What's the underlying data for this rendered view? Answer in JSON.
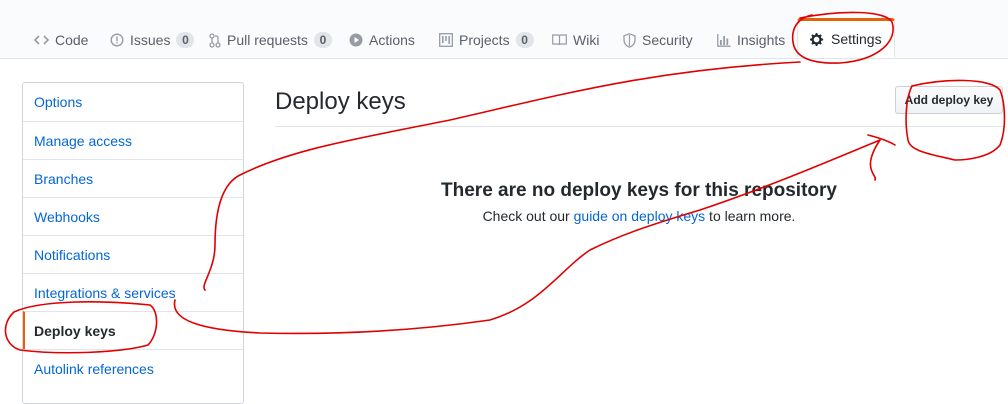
{
  "repo_nav": {
    "tabs": [
      {
        "label": "Code",
        "icon": "code-icon"
      },
      {
        "label": "Issues",
        "icon": "issue-icon",
        "count": "0"
      },
      {
        "label": "Pull requests",
        "icon": "pull-request-icon",
        "count": "0"
      },
      {
        "label": "Actions",
        "icon": "play-icon"
      },
      {
        "label": "Projects",
        "icon": "project-icon",
        "count": "0"
      },
      {
        "label": "Wiki",
        "icon": "book-icon"
      },
      {
        "label": "Security",
        "icon": "shield-icon"
      },
      {
        "label": "Insights",
        "icon": "graph-icon"
      },
      {
        "label": "Settings",
        "icon": "gear-icon",
        "selected": true
      }
    ]
  },
  "sidebar": {
    "items": [
      {
        "label": "Options"
      },
      {
        "label": "Manage access"
      },
      {
        "label": "Branches"
      },
      {
        "label": "Webhooks"
      },
      {
        "label": "Notifications"
      },
      {
        "label": "Integrations & services"
      },
      {
        "label": "Deploy keys",
        "selected": true
      },
      {
        "label": "Autolink references"
      }
    ]
  },
  "main": {
    "title": "Deploy keys",
    "add_button_label": "Add deploy key",
    "blankslate": {
      "title": "There are no deploy keys for this repository",
      "desc_before": "Check out our ",
      "desc_link": "guide on deploy keys",
      "desc_after": " to learn more."
    }
  },
  "colors": {
    "accent": "#e36209",
    "link": "#0366d6",
    "annotation": "#e00000"
  }
}
